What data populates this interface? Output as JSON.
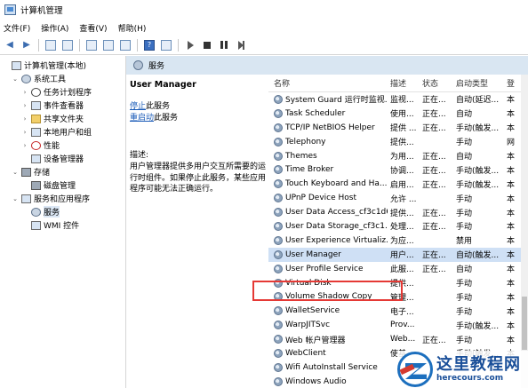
{
  "window": {
    "title": "计算机管理"
  },
  "menu": [
    "文件(F)",
    "操作(A)",
    "查看(V)",
    "帮助(H)"
  ],
  "tree": [
    {
      "label": "计算机管理(本地)",
      "arrow": "",
      "icon": "computer-icon",
      "indent": 0
    },
    {
      "label": "系统工具",
      "arrow": "⌄",
      "icon": "tools-icon",
      "indent": 1
    },
    {
      "label": "任务计划程序",
      "arrow": "›",
      "icon": "clock-icon",
      "indent": 2
    },
    {
      "label": "事件查看器",
      "arrow": "›",
      "icon": "event-viewer-icon",
      "indent": 2
    },
    {
      "label": "共享文件夹",
      "arrow": "›",
      "icon": "folder-icon",
      "indent": 2
    },
    {
      "label": "本地用户和组",
      "arrow": "›",
      "icon": "users-icon",
      "indent": 2
    },
    {
      "label": "性能",
      "arrow": "›",
      "icon": "performance-icon",
      "indent": 2
    },
    {
      "label": "设备管理器",
      "arrow": "",
      "icon": "device-manager-icon",
      "indent": 2
    },
    {
      "label": "存储",
      "arrow": "⌄",
      "icon": "storage-icon",
      "indent": 1
    },
    {
      "label": "磁盘管理",
      "arrow": "",
      "icon": "disk-icon",
      "indent": 2
    },
    {
      "label": "服务和应用程序",
      "arrow": "⌄",
      "icon": "services-apps-icon",
      "indent": 1
    },
    {
      "label": "服务",
      "arrow": "",
      "icon": "services-icon",
      "indent": 2,
      "selected": true
    },
    {
      "label": "WMI 控件",
      "arrow": "",
      "icon": "wmi-icon",
      "indent": 2
    }
  ],
  "main": {
    "header": "服务",
    "service_title": "User Manager",
    "stop_link": "停止",
    "stop_suffix": "此服务",
    "restart_link": "重启动",
    "restart_suffix": "此服务",
    "desc_label": "描述:",
    "desc_text": "用户管理器提供多用户交互所需要的运行时组件。如果停止此服务，某些应用程序可能无法正确运行。"
  },
  "columns": [
    "名称",
    "描述",
    "状态",
    "启动类型",
    "登"
  ],
  "rows": [
    {
      "name": "System Guard 运行时监视...",
      "desc": "监视...",
      "status": "正在...",
      "start": "自动(延迟...",
      "login": "本"
    },
    {
      "name": "Task Scheduler",
      "desc": "使用...",
      "status": "正在...",
      "start": "自动",
      "login": "本"
    },
    {
      "name": "TCP/IP NetBIOS Helper",
      "desc": "提供 ...",
      "status": "正在...",
      "start": "手动(触发...",
      "login": "本"
    },
    {
      "name": "Telephony",
      "desc": "提供...",
      "status": "",
      "start": "手动",
      "login": "网"
    },
    {
      "name": "Themes",
      "desc": "为用...",
      "status": "正在...",
      "start": "自动",
      "login": "本"
    },
    {
      "name": "Time Broker",
      "desc": "协调...",
      "status": "正在...",
      "start": "手动(触发...",
      "login": "本"
    },
    {
      "name": "Touch Keyboard and Ha...",
      "desc": "启用...",
      "status": "正在...",
      "start": "手动(触发...",
      "login": "本"
    },
    {
      "name": "UPnP Device Host",
      "desc": "允许 ...",
      "status": "",
      "start": "手动",
      "login": "本"
    },
    {
      "name": "User Data Access_cf3c1d6",
      "desc": "提供...",
      "status": "正在...",
      "start": "手动",
      "login": "本"
    },
    {
      "name": "User Data Storage_cf3c1...",
      "desc": "处理...",
      "status": "正在...",
      "start": "手动",
      "login": "本"
    },
    {
      "name": "User Experience Virtualiz...",
      "desc": "为应...",
      "status": "",
      "start": "禁用",
      "login": "本"
    },
    {
      "name": "User Manager",
      "desc": "用户...",
      "status": "正在...",
      "start": "自动(触发...",
      "login": "本",
      "selected": true
    },
    {
      "name": "User Profile Service",
      "desc": "此服...",
      "status": "正在...",
      "start": "自动",
      "login": "本"
    },
    {
      "name": "Virtual Disk",
      "desc": "提供...",
      "status": "",
      "start": "手动",
      "login": "本"
    },
    {
      "name": "Volume Shadow Copy",
      "desc": "管理...",
      "status": "",
      "start": "手动",
      "login": "本"
    },
    {
      "name": "WalletService",
      "desc": "电子...",
      "status": "",
      "start": "手动",
      "login": "本"
    },
    {
      "name": "WarpJITSvc",
      "desc": "Prov...",
      "status": "",
      "start": "手动(触发...",
      "login": "本"
    },
    {
      "name": "Web 帐户管理器",
      "desc": "Web...",
      "status": "正在...",
      "start": "手动",
      "login": "本"
    },
    {
      "name": "WebClient",
      "desc": "使基...",
      "status": "",
      "start": "手动(触发...",
      "login": "本"
    },
    {
      "name": "Wifi AutoInstall Service",
      "desc": "",
      "status": "",
      "start": "",
      "login": ""
    },
    {
      "name": "Windows Audio",
      "desc": "",
      "status": "",
      "start": "",
      "login": ""
    }
  ],
  "watermark": {
    "title": "这里教程网",
    "url": "herecours.com"
  }
}
